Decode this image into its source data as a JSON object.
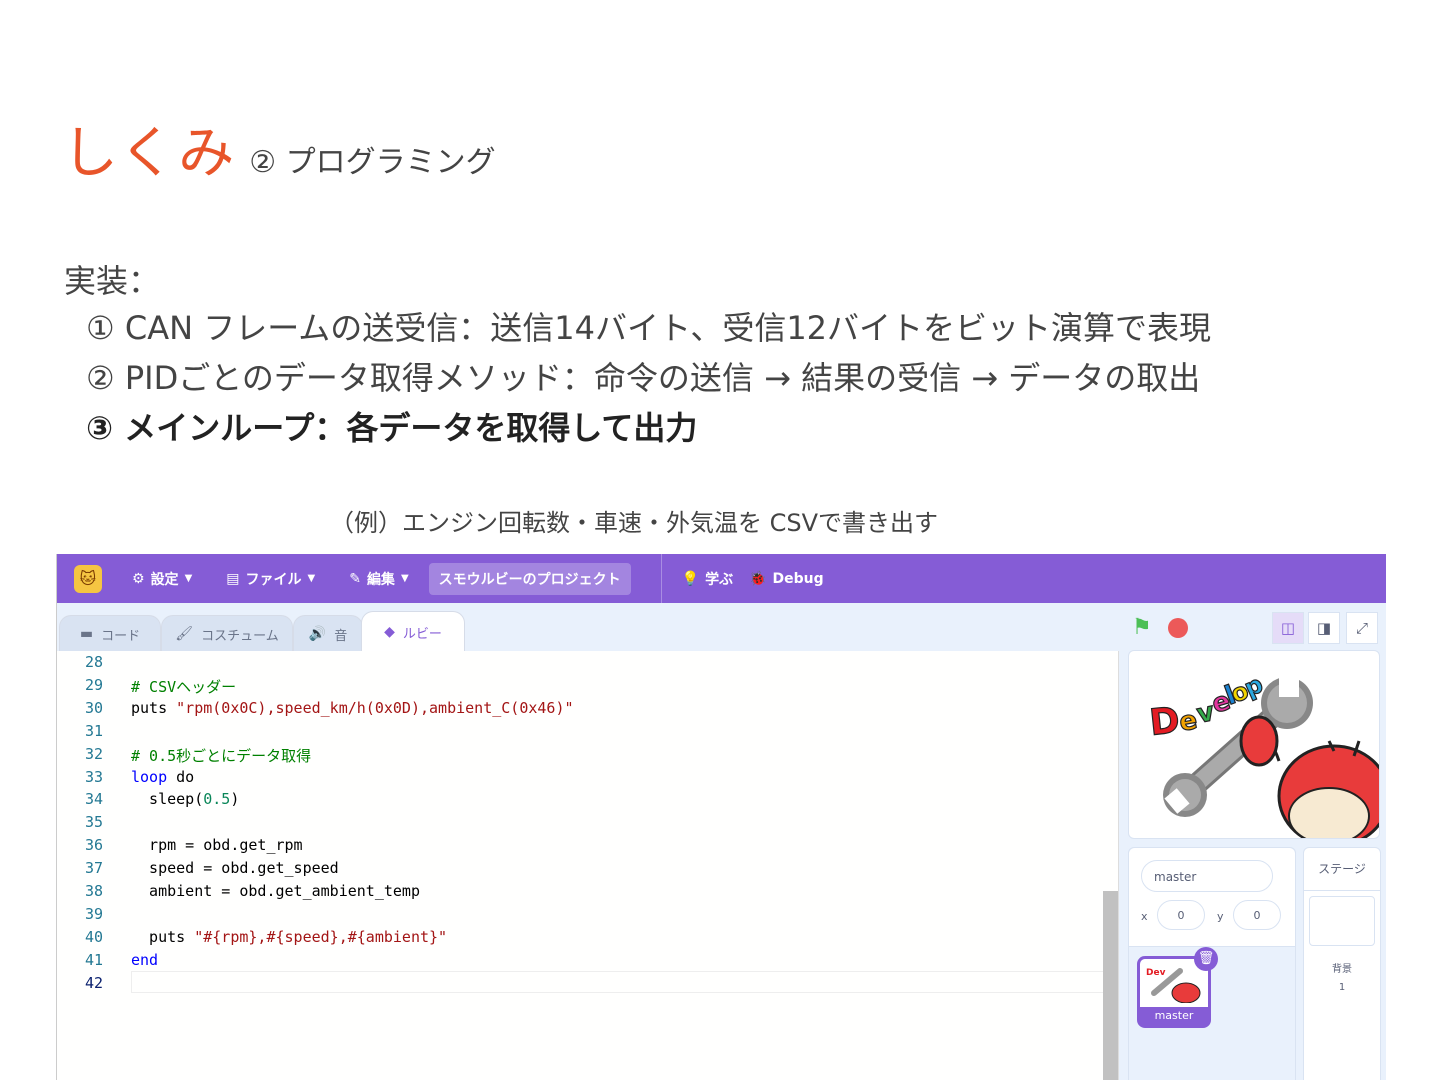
{
  "slide": {
    "title_main": "しくみ",
    "title_sub": "② プログラミング",
    "impl_label": "実装：",
    "impl_items": [
      "① CAN フレームの送受信：送信14バイト、受信12バイトをビット演算で表現",
      "② PIDごとのデータ取得メソッド：命令の送信 → 結果の受信 → データの取出",
      "③ メインループ：各データを取得して出力"
    ],
    "example_caption": "（例）エンジン回転数・車速・外気温を CSVで書き出す"
  },
  "app": {
    "colors": {
      "menubar": "#855cd6",
      "accent": "#855cd6",
      "flag": "#4cbf56",
      "stop": "#ec5959"
    },
    "menubar": {
      "logo_icon": "smalruby-cat-logo",
      "settings_label": "設定",
      "file_label": "ファイル",
      "edit_label": "編集",
      "project_title": "スモウルビーのプロジェクト",
      "learn_label": "学ぶ",
      "debug_label": "Debug"
    },
    "tabs": [
      {
        "label": "コード",
        "icon": "code-icon"
      },
      {
        "label": "コスチューム",
        "icon": "brush-icon"
      },
      {
        "label": "音",
        "icon": "speaker-icon"
      },
      {
        "label": "ルビー",
        "icon": "ruby-icon"
      }
    ],
    "active_tab": "ルビー",
    "editor": {
      "current_line": 42,
      "lines": [
        {
          "n": "28",
          "text": ""
        },
        {
          "n": "29",
          "text": "# CSVヘッダー"
        },
        {
          "n": "30",
          "text": "puts \"rpm(0x0C),speed_km/h(0x0D),ambient_C(0x46)\""
        },
        {
          "n": "31",
          "text": ""
        },
        {
          "n": "32",
          "text": "# 0.5秒ごとにデータ取得"
        },
        {
          "n": "33",
          "text": "loop do"
        },
        {
          "n": "34",
          "text": "  sleep(0.5)"
        },
        {
          "n": "35",
          "text": ""
        },
        {
          "n": "36",
          "text": "  rpm = obd.get_rpm"
        },
        {
          "n": "37",
          "text": "  speed = obd.get_speed"
        },
        {
          "n": "38",
          "text": "  ambient = obd.get_ambient_temp"
        },
        {
          "n": "39",
          "text": ""
        },
        {
          "n": "40",
          "text": "  puts \"#{rpm},#{speed},#{ambient}\""
        },
        {
          "n": "41",
          "text": "end"
        },
        {
          "n": "42",
          "text": ""
        }
      ]
    },
    "stage_image_text": "Develop",
    "sprite": {
      "name": "master",
      "x_label": "x",
      "x": "0",
      "y_label": "y",
      "y": "0",
      "tile_label": "master"
    },
    "stage_pane": {
      "title": "ステージ",
      "backdrop_label": "背景",
      "backdrop_count": "1"
    }
  }
}
